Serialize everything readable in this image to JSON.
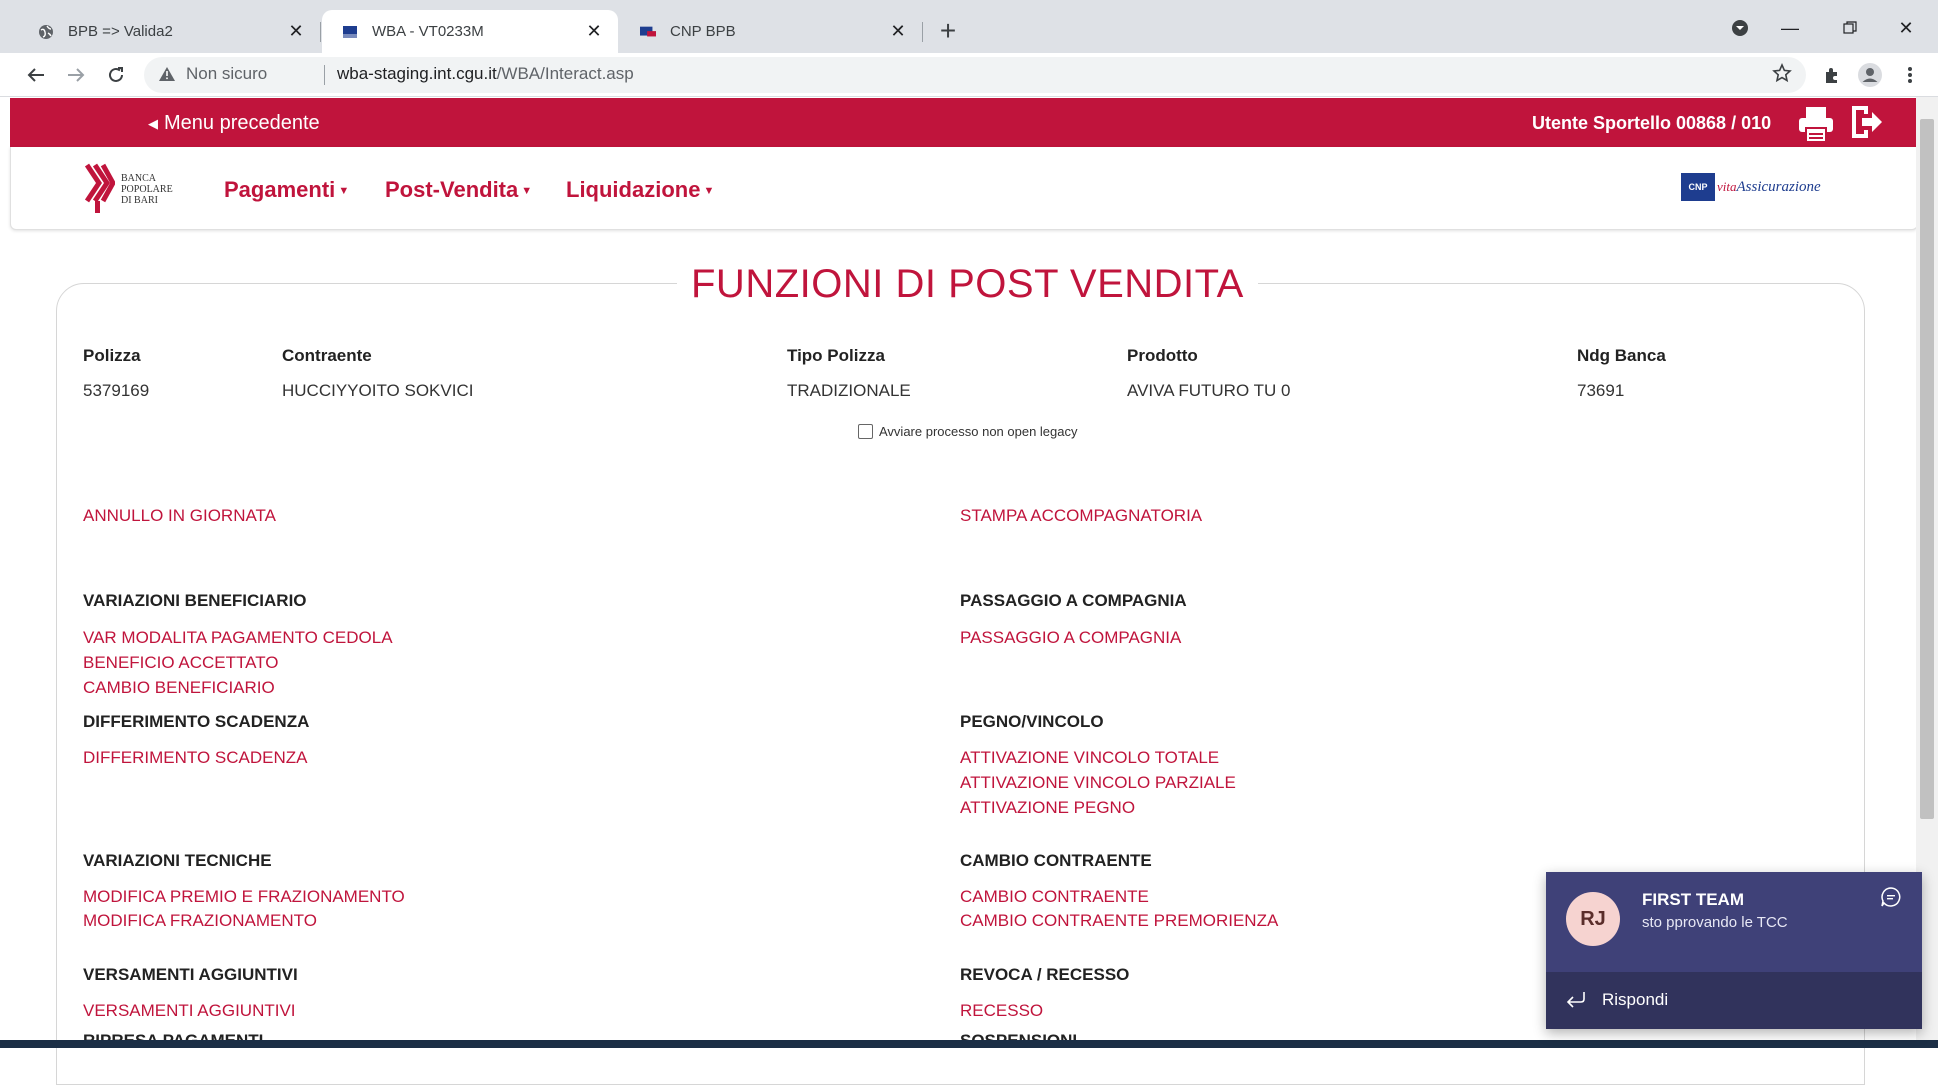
{
  "browser": {
    "tabs": [
      {
        "title": "BPB => Valida2",
        "favicon": "globe-icon",
        "active": false
      },
      {
        "title": "WBA - VT0233M",
        "favicon": "cnp-favicon",
        "active": true
      },
      {
        "title": "CNP BPB",
        "favicon": "flag-favicon",
        "active": false
      }
    ],
    "security_label": "Non sicuro",
    "url_host": "wba-staging.int.cgu.it",
    "url_path": "/WBA/Interact.asp"
  },
  "topbar": {
    "back_label": "Menu precedente",
    "user_label": "Utente Sportello 00868 / 010"
  },
  "logo": {
    "bank_name_lines": [
      "BANCA",
      "POPOLARE",
      "DI BARI"
    ],
    "partner_box": "CNP",
    "partner_vita": "vita",
    "partner_name": "Assicurazione"
  },
  "menu": [
    {
      "label": "Pagamenti"
    },
    {
      "label": "Post-Vendita"
    },
    {
      "label": "Liquidazione"
    }
  ],
  "page": {
    "title": "FUNZIONI DI POST VENDITA",
    "fields": [
      {
        "label": "Polizza",
        "value": "5379169"
      },
      {
        "label": "Contraente",
        "value": "HUCCIYYOITO SOKVICI"
      },
      {
        "label": "Tipo Polizza",
        "value": "TRADIZIONALE"
      },
      {
        "label": "Prodotto",
        "value": "AVIVA FUTURO TU 0"
      },
      {
        "label": "Ndg Banca",
        "value": "73691"
      }
    ],
    "legacy_checkbox_label": "Avviare processo non open legacy",
    "left_column": {
      "top_link": "ANNULLO IN GIORNATA",
      "sections": [
        {
          "heading": "VARIAZIONI BENEFICIARIO",
          "links": [
            "VAR MODALITA PAGAMENTO CEDOLA",
            "BENEFICIO ACCETTATO",
            "CAMBIO BENEFICIARIO"
          ]
        },
        {
          "heading": "DIFFERIMENTO SCADENZA",
          "links": [
            "DIFFERIMENTO SCADENZA"
          ]
        },
        {
          "heading": "VARIAZIONI TECNICHE",
          "links": [
            "MODIFICA PREMIO E FRAZIONAMENTO",
            "MODIFICA FRAZIONAMENTO"
          ]
        },
        {
          "heading": "VERSAMENTI AGGIUNTIVI",
          "links": [
            "VERSAMENTI AGGIUNTIVI"
          ]
        },
        {
          "heading": "RIPRESA PAGAMENTI",
          "links": []
        }
      ]
    },
    "right_column": {
      "top_link": "STAMPA ACCOMPAGNATORIA",
      "sections": [
        {
          "heading": "PASSAGGIO A COMPAGNIA",
          "links": [
            "PASSAGGIO A COMPAGNIA"
          ]
        },
        {
          "heading": "PEGNO/VINCOLO",
          "links": [
            "ATTIVAZIONE VINCOLO TOTALE",
            "ATTIVAZIONE VINCOLO PARZIALE",
            "ATTIVAZIONE PEGNO"
          ]
        },
        {
          "heading": "CAMBIO CONTRAENTE",
          "links": [
            "CAMBIO CONTRAENTE",
            "CAMBIO CONTRAENTE PREMORIENZA"
          ]
        },
        {
          "heading": "REVOCA / RECESSO",
          "links": [
            "RECESSO"
          ]
        },
        {
          "heading": "SOSPENSIONI",
          "links": []
        }
      ]
    }
  },
  "notification": {
    "initials": "RJ",
    "sender": "FIRST TEAM",
    "message": "sto pprovando le TCC",
    "reply_label": "Rispondi"
  },
  "colors": {
    "brand_red": "#c0143c",
    "toast_bg": "#3f4178",
    "partner_blue": "#1e3d8f"
  }
}
